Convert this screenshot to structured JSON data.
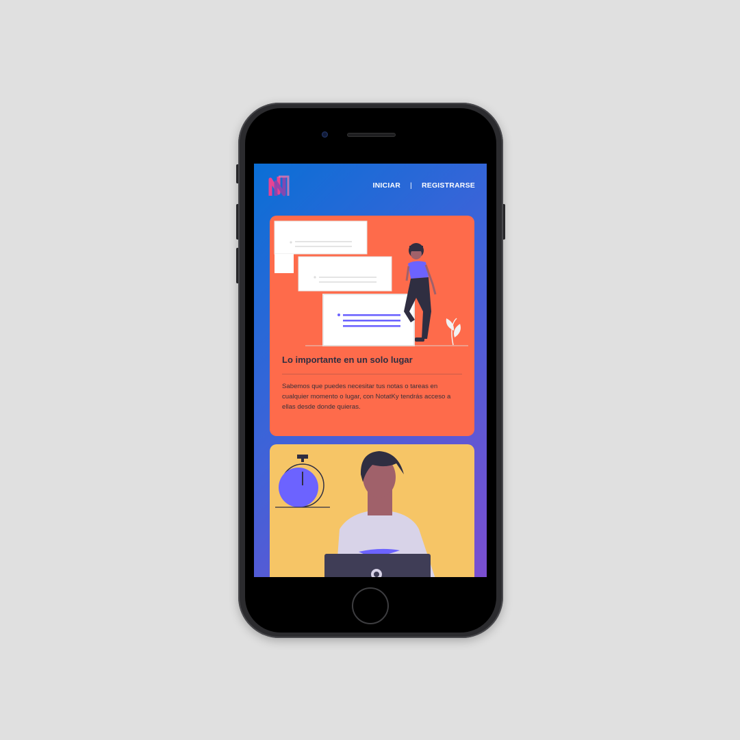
{
  "app": {
    "logo_icon": "notatky-logo-icon",
    "brand_colors": {
      "blue": "#0a6fd6",
      "purple": "#7b4ed0",
      "pink": "#e84393"
    }
  },
  "nav": {
    "login": "INICIAR",
    "separator": "|",
    "register": "REGISTRARSE"
  },
  "features": [
    {
      "title": "Lo importante en un solo lugar",
      "description": "Sabemos que puedes necesitar tus notas o tareas en cualquier momento o lugar, con NotatKy tendrás acceso a ellas desde donde quieras.",
      "illustration_icon": "notes-woman-illustration",
      "color": "#fe6b4b"
    },
    {
      "illustration_icon": "stopwatch-laptop-man-illustration",
      "color": "#f6c566"
    }
  ]
}
